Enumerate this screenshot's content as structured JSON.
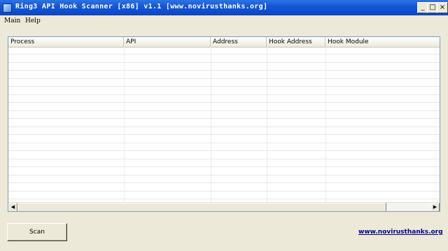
{
  "window": {
    "title": "Ring3 API Hook Scanner [x86] v1.1 [www.novirusthanks.org]",
    "controls": {
      "minimize": "_",
      "maximize": "□",
      "close": "×"
    }
  },
  "menu": {
    "items": [
      {
        "label": "Main"
      },
      {
        "label": "Help"
      }
    ]
  },
  "table": {
    "columns": [
      "Process",
      "API",
      "Address",
      "Hook Address",
      "Hook Module"
    ],
    "rows": []
  },
  "scrollbar": {
    "left_arrow": "◀",
    "right_arrow": "▶"
  },
  "footer": {
    "scan_label": "Scan",
    "link_text": "www.novirusthanks.org"
  },
  "colors": {
    "titlebar": "#0a46c8",
    "window_bg": "#ece9d8",
    "link": "#00008b"
  }
}
